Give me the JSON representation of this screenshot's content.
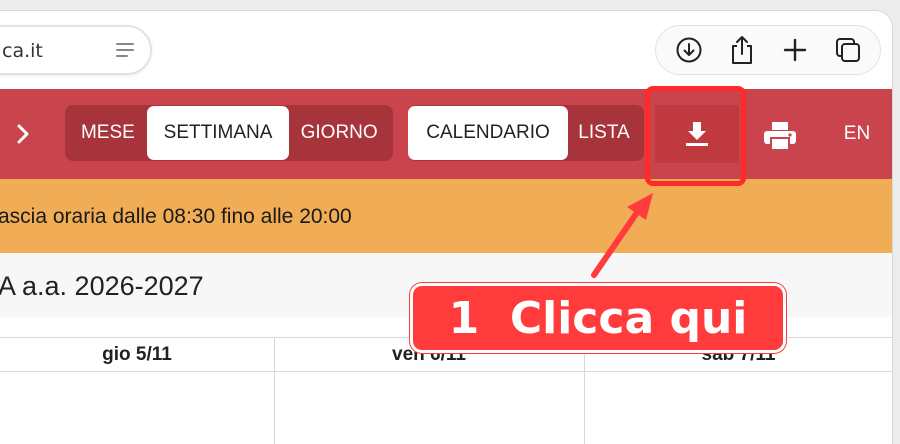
{
  "browser": {
    "address_text": "ca.it",
    "actions": [
      "download-icon",
      "share-icon",
      "new-tab-icon",
      "tabs-icon"
    ]
  },
  "toolbar": {
    "views": [
      "MESE",
      "SETTIMANA",
      "GIORNO"
    ],
    "active_view": "SETTIMANA",
    "types": [
      "CALENDARIO",
      "LISTA"
    ],
    "active_type": "CALENDARIO",
    "lang_label": "EN"
  },
  "info": {
    "time_range": "ascia oraria dalle 08:30 fino alle 20:00",
    "academic_year": "A a.a. 2026-2027"
  },
  "days": [
    "gio 5/11",
    "ven 6/11",
    "sab 7/11"
  ],
  "annotation": {
    "label": "1  Clicca qui"
  },
  "colors": {
    "header": "#c9444c",
    "group": "#a8343b",
    "info_bar": "#f0ad55",
    "highlight": "#ff2a2a"
  }
}
